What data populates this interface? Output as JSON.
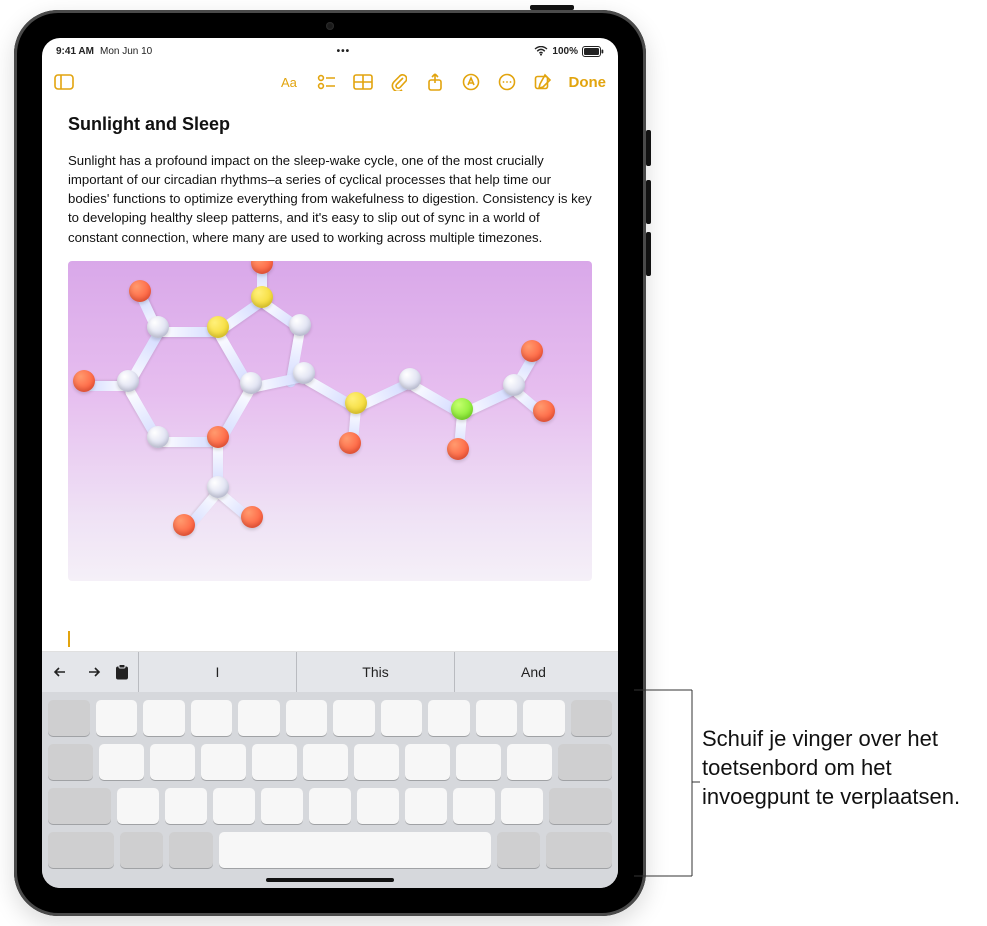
{
  "status": {
    "time": "9:41 AM",
    "date": "Mon Jun 10",
    "battery_pct": "100%"
  },
  "toolbar": {
    "done_label": "Done"
  },
  "note": {
    "title": "Sunlight and Sleep",
    "body": "Sunlight has a profound impact on the sleep-wake cycle, one of the most crucially important of our circadian rhythms–a series of cyclical processes that help time our bodies' functions to optimize everything from wakefulness to digestion. Consistency is key to developing healthy sleep patterns, and it's easy to slip out of sync in a world of constant connection, where many are used to working across multiple timezones."
  },
  "keyboard": {
    "predictions": [
      "I",
      "This",
      "And"
    ]
  },
  "callout": {
    "text": "Schuif je vinger over het toetsenbord om het invoegpunt te verplaatsen."
  }
}
